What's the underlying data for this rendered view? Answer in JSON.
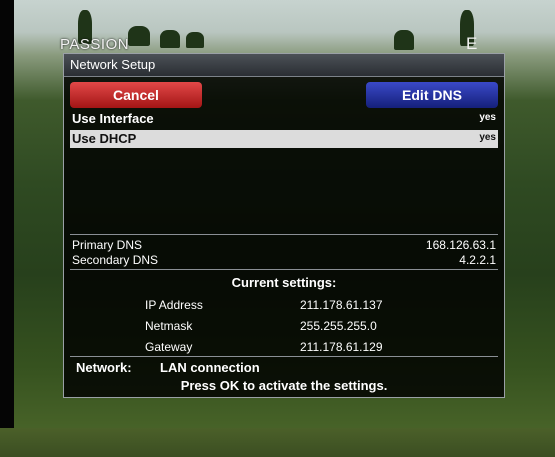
{
  "overlay": {
    "channel_name": "PASSION",
    "channel_right": "E"
  },
  "dialog": {
    "title": "Network Setup",
    "buttons": {
      "cancel": "Cancel",
      "edit_dns": "Edit DNS"
    },
    "options": [
      {
        "label": "Use Interface",
        "value": "yes",
        "selected": false
      },
      {
        "label": "Use DHCP",
        "value": "yes",
        "selected": true
      }
    ],
    "dns": {
      "primary_label": "Primary DNS",
      "primary_value": "168.126.63.1",
      "secondary_label": "Secondary DNS",
      "secondary_value": "4.2.2.1"
    },
    "current": {
      "title": "Current settings:",
      "ip_label": "IP Address",
      "ip_value": "211.178.61.137",
      "netmask_label": "Netmask",
      "netmask_value": "255.255.255.0",
      "gateway_label": "Gateway",
      "gateway_value": "211.178.61.129"
    },
    "network": {
      "label": "Network:",
      "value": "LAN connection"
    },
    "hint": "Press OK to activate the settings."
  },
  "colors": {
    "cancel_button": "#c62828",
    "edit_dns_button": "#1d2aa0",
    "selected_row": "#dcdcdc"
  }
}
